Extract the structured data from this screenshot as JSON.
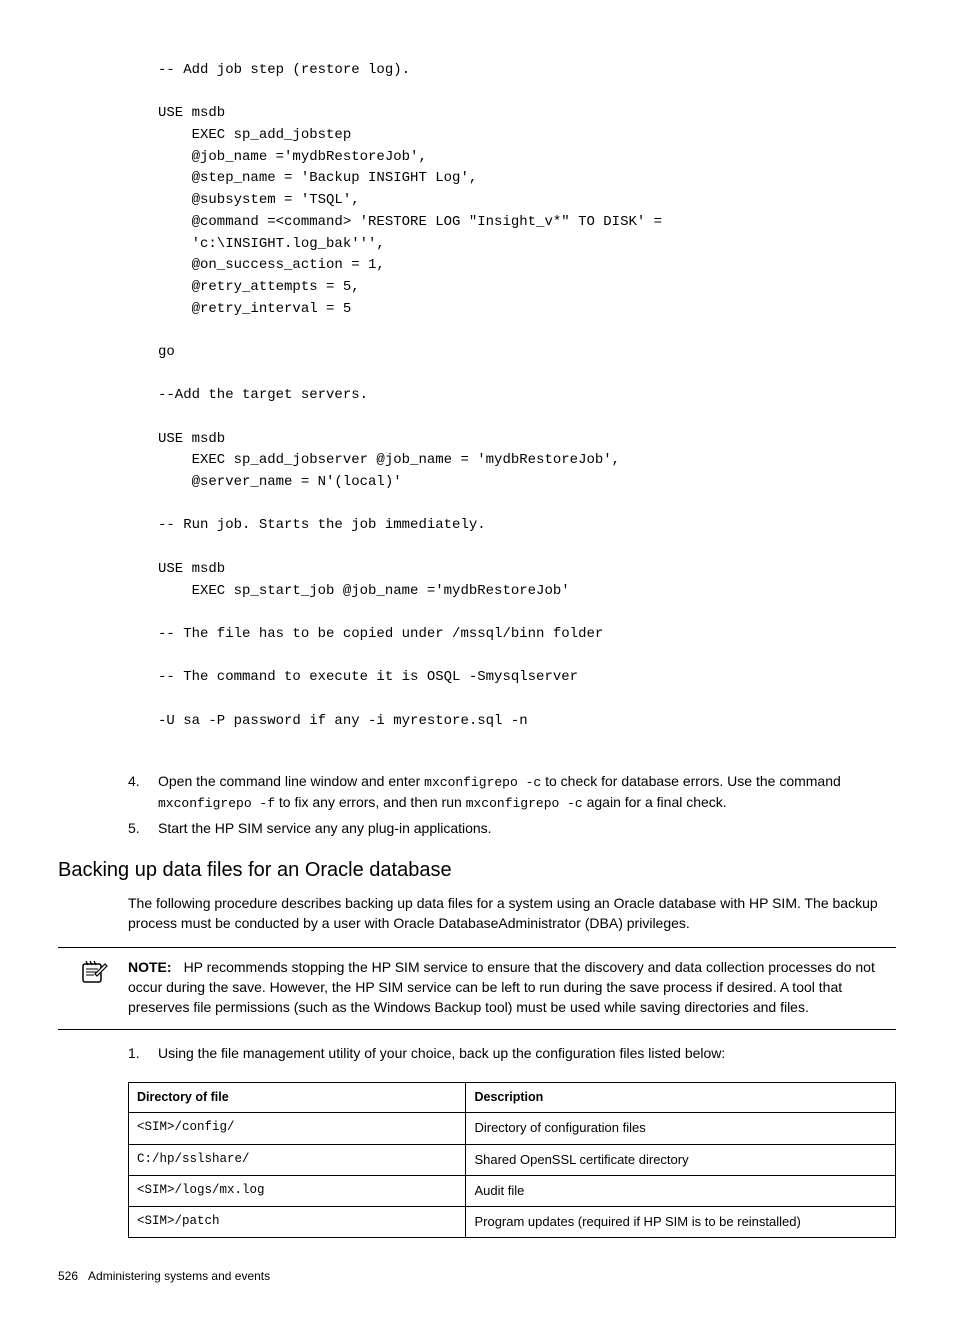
{
  "code": "-- Add job step (restore log).\n\nUSE msdb\n    EXEC sp_add_jobstep\n    @job_name ='mydbRestoreJob',\n    @step_name = 'Backup INSIGHT Log',\n    @subsystem = 'TSQL',\n    @command =<command> 'RESTORE LOG \"Insight_v*\" TO DISK' =\n    'c:\\INSIGHT.log_bak''',\n    @on_success_action = 1,\n    @retry_attempts = 5,\n    @retry_interval = 5\n\ngo\n\n--Add the target servers.\n\nUSE msdb\n    EXEC sp_add_jobserver @job_name = 'mydbRestoreJob',\n    @server_name = N'(local)'\n\n-- Run job. Starts the job immediately.\n\nUSE msdb\n    EXEC sp_start_job @job_name ='mydbRestoreJob'\n\n-- The file has to be copied under /mssql/binn folder\n\n-- The command to execute it is OSQL -Smysqlserver\n\n-U sa -P password if any -i myrestore.sql -n",
  "steps": {
    "s4": {
      "num": "4.",
      "pre": "Open the command line window and enter ",
      "cmd1": "mxconfigrepo -c",
      "mid1": " to check for database errors. Use the command ",
      "cmd2": "mxconfigrepo -f",
      "mid2": " to fix any errors, and then run ",
      "cmd3": "mxconfigrepo -c",
      "post": " again for a final check."
    },
    "s5": {
      "num": "5.",
      "text": "Start the HP SIM service any any plug-in applications."
    }
  },
  "heading": "Backing up data files for an Oracle database",
  "intro": "The following procedure describes backing up data files for a system using an Oracle database with HP SIM. The backup process must be conducted by a user with Oracle DatabaseAdministrator (DBA) privileges.",
  "note": {
    "label": "NOTE:",
    "text": "HP recommends stopping the HP SIM service to ensure that the discovery and data collection processes do not occur during the save. However, the HP SIM service can be left to run during the save process if desired. A tool that preserves file permissions (such as the Windows Backup tool) must be used while saving directories and files."
  },
  "step1": {
    "num": "1.",
    "text": "Using the file management utility of your choice, back up the configuration files listed below:"
  },
  "table": {
    "h1": "Directory of file",
    "h2": "Description",
    "rows": [
      {
        "path": "<SIM>/config/",
        "desc": "Directory of configuration files"
      },
      {
        "path": "C:/hp/sslshare/",
        "desc": "Shared OpenSSL certificate directory"
      },
      {
        "path": "<SIM>/logs/mx.log",
        "desc": "Audit file"
      },
      {
        "path": "<SIM>/patch",
        "desc": "Program updates (required if HP SIM is to be reinstalled)"
      }
    ]
  },
  "footer": {
    "page": "526",
    "title": "Administering systems and events"
  }
}
